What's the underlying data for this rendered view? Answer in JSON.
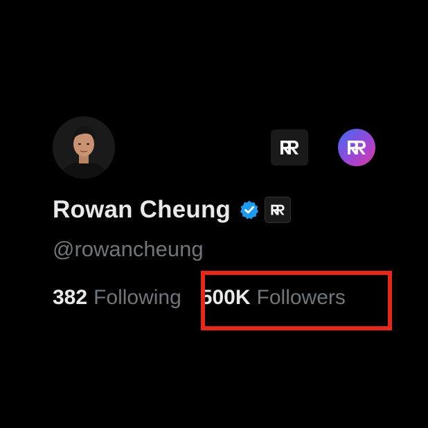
{
  "profile": {
    "name": "Rowan Cheung",
    "handle": "@rowancheung",
    "stats": [
      {
        "value": "382",
        "label": "Following"
      },
      {
        "value": "500K",
        "label": "Followers"
      }
    ]
  },
  "icons": {
    "avatar": "profile-photo",
    "verified": "verified-badge-icon",
    "affiliate": "rundown-logo-icon"
  },
  "colors": {
    "background": "#000000",
    "name": "#e7e9ea",
    "secondary_text": "#71767b",
    "verified_blue": "#1d9bf0",
    "highlight": "#e8261a"
  }
}
